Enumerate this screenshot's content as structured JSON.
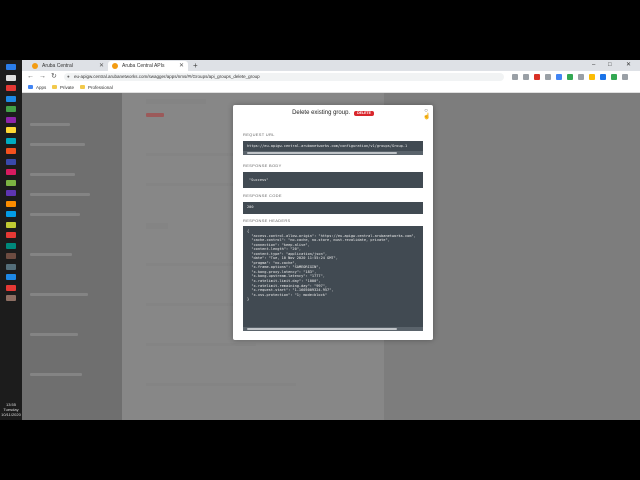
{
  "taskbar": {
    "time": "13:55",
    "day": "Tuesday",
    "date": "10/11/2020",
    "icon_colors": [
      "#2b7de9",
      "#e0e0e0",
      "#e53935",
      "#1e88e5",
      "#43a047",
      "#8e24aa",
      "#fdd835",
      "#00acc1",
      "#f4511e",
      "#3949ab",
      "#d81b60",
      "#7cb342",
      "#5e35b1",
      "#fb8c00",
      "#039be5",
      "#c0ca33",
      "#e53935",
      "#00897b",
      "#6d4c41",
      "#546e7a",
      "#1e88e5",
      "#e53935",
      "#8d6e63"
    ]
  },
  "browser": {
    "tabs": [
      {
        "title": "Aruba Central",
        "active": false
      },
      {
        "title": "Aruba Central APIs",
        "active": true
      }
    ],
    "new_tab": "+",
    "window_controls": {
      "minimize": "–",
      "maximize": "□",
      "close": "✕"
    },
    "nav": {
      "back": "←",
      "forward": "→",
      "reload": "↻"
    },
    "url": "eu-apigw.central.arubanetworks.com/swagger/apps/nms/#!/Groups/api_groups_delete_group",
    "bookmarks": [
      "Apps",
      "Private",
      "Professional"
    ],
    "extension_colors": [
      "#9aa0a6",
      "#9aa0a6",
      "#d93025",
      "#9aa0a6",
      "#4285f4",
      "#34a853",
      "#9aa0a6",
      "#fbbc04",
      "#1a73e8",
      "#34a853",
      "#9aa0a6"
    ]
  },
  "modal": {
    "title": "Delete existing group.",
    "method": "DELETE",
    "close_icon": "close-icon",
    "request_url_label": "REQUEST URL",
    "request_url": "https://eu-apigw.central.arubanetworks.com/configuration/v1/groups/Group-1",
    "response_body_label": "RESPONSE BODY",
    "response_body": "\"Success\"",
    "response_code_label": "RESPONSE CODE",
    "response_code": "200",
    "response_headers_label": "RESPONSE HEADERS",
    "response_headers": "{\n  \"access-control-allow-origin\": \"https://eu-apigw.central.arubanetworks.com\",\n  \"cache-control\": \"no-cache, no-store, must-revalidate, private\",\n  \"connection\": \"keep-alive\",\n  \"content-length\": \"20\",\n  \"content-type\": \"application/json\",\n  \"date\": \"Tue, 10 Nov 2020 11:55:24 GMT\",\n  \"pragma\": \"no-cache\",\n  \"x-frame-options\": \"SAMEORIGIN\",\n  \"x-kong-proxy-latency\": \"183\",\n  \"x-kong-upstream-latency\": \"1777\",\n  \"x-ratelimit-limit-day\": \"1000\",\n  \"x-ratelimit-remaining-day\": \"997\",\n  \"x-request-start\": \"1-1605009324.957\",\n  \"x-xss-protection\": \"1; mode=block\"\n}"
  },
  "colors": {
    "accent": "#d9262c",
    "code_bg": "#414a52",
    "overlay": "#7d7d7d"
  }
}
